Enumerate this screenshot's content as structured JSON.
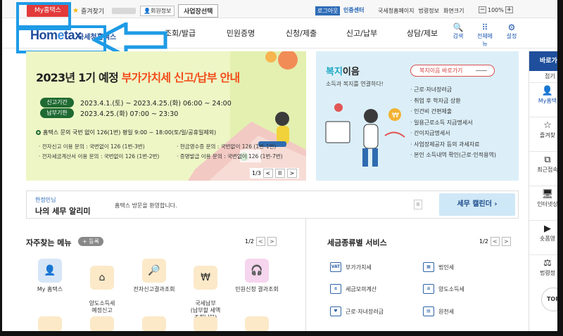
{
  "util": {
    "my_hometax": "My홈택스",
    "bookmark": "즐겨찾기",
    "member_info": "회원정보",
    "biz_select": "사업장선택",
    "logout": "로그아웃",
    "cert_center": "인증센터",
    "national_tax": "국세청홈페이지",
    "law_info": "법령정보",
    "screen_size": "화면크기",
    "zoom_minus": "−",
    "zoom": "100%",
    "zoom_plus": "+"
  },
  "header": {
    "logo_a": "Hom",
    "logo_b": "e",
    "logo_c": "tax",
    "logo_sub": "국세청홈택스",
    "nav": [
      "조회/발급",
      "민원증명",
      "신청/제출",
      "신고/납부",
      "상담/제보"
    ],
    "icons": [
      {
        "label": "검색",
        "icon": "search-icon",
        "glyph": "🔍"
      },
      {
        "label": "전체메뉴",
        "icon": "grid-icon",
        "glyph": "⠿"
      },
      {
        "label": "설정",
        "icon": "gear-icon",
        "glyph": "⚙"
      }
    ]
  },
  "banner": {
    "title_a": "2023년 1기 예정 ",
    "title_b": "부가가치세 신고/납부 안내",
    "period_label": "신고기간",
    "period_value": "2023.4.1.(토) ~ 2023.4.25.(화) 06:00 ~ 24:00",
    "due_label": "납부기한",
    "due_value": "2023.4.25.(화) 07:00 ~ 23:30",
    "inquiry": "홈택스 문의 국번 없이 126(1번) 평일 9:00 ~ 18:00(토/일/공휴일제외)",
    "inq1": "· 전자신고 이용 문의 : 국번없이 126 (1번-3번)",
    "inq2": "· 전자세금계산서 이용 문의 : 국번없이 126 (1번-2번)",
    "inq3": "· 현금영수증 문의 : 국번없이 126 (1번-1번)",
    "inq4": "· 증명발급 이용 문의 : 국번없이 126 (1번-7번)",
    "page": "1/3",
    "prev": "<",
    "pause": "II",
    "next": ">"
  },
  "welfare": {
    "title_a": "복지",
    "title_b": "이음",
    "subtitle": "소득과 복지를 연결하다!",
    "button": "복지이음 바로가기",
    "items": [
      "근로·자녀장려금",
      "취업 후 학자금 상환",
      "인건비 간편제출",
      "일용근로소득 지급명세서",
      "간이지급명세서",
      "사업장제공자 등의 과세자료",
      "본인 소득내역 확인(근로·인적용역)"
    ]
  },
  "notice": {
    "small": "한정민님",
    "big": "나의 세무 알리미",
    "welcome": "홈택스 방문을 환영합니다.",
    "pause": "II",
    "calendar": "세무 캘린더"
  },
  "fav": {
    "title": "자주찾는 메뉴",
    "register": "+ 등록",
    "page": "1/2",
    "prev": "<",
    "next": ">",
    "items": [
      {
        "label": "My 홈택스",
        "icon": "user-icon",
        "glyph": "👤",
        "bg": "#d6e6f7"
      },
      {
        "label": "양도소득세\n예정신고",
        "icon": "house-icon",
        "glyph": "⌂",
        "bg": "#fbe9c8"
      },
      {
        "label": "전자신고결과조회",
        "icon": "document-search-icon",
        "glyph": "🔎",
        "bg": "#fbe9c8"
      },
      {
        "label": "국세납부\n(납부할 세액\n조회납부)",
        "icon": "piggy-bank-icon",
        "glyph": "₩",
        "bg": "#fbe9c8"
      },
      {
        "label": "민원신청 결과조회",
        "icon": "headset-icon",
        "glyph": "🎧",
        "bg": "#f6d5ee"
      }
    ]
  },
  "services": {
    "title": "세금종류별 서비스",
    "page": "1/2",
    "prev": "<",
    "next": ">",
    "items": [
      {
        "label": "부가가치세",
        "icon": "vat-icon",
        "glyph": "VAT"
      },
      {
        "label": "법인세",
        "icon": "building-icon",
        "glyph": "▦"
      },
      {
        "label": "세금모의계산",
        "icon": "calculator-icon",
        "glyph": "±"
      },
      {
        "label": "양도소득세",
        "icon": "document-icon",
        "glyph": "≡"
      },
      {
        "label": "근로·자녀장려금",
        "icon": "heart-hand-icon",
        "glyph": "♥"
      },
      {
        "label": "원천세",
        "icon": "ledger-icon",
        "glyph": "▤"
      }
    ]
  },
  "quick": {
    "header": "바로가",
    "fold": "접기",
    "items": [
      {
        "label": "My홈택",
        "icon": "user-icon",
        "glyph": "👤"
      },
      {
        "label": "즐겨찾",
        "icon": "star-icon",
        "glyph": "☆"
      },
      {
        "label": "최근접속",
        "icon": "recent-icon",
        "glyph": "⧉"
      },
      {
        "label": "인터넷상",
        "icon": "monitor-icon",
        "glyph": "🖥"
      },
      {
        "label": "숏폼영",
        "icon": "video-icon",
        "glyph": "▶"
      },
      {
        "label": "법령정",
        "icon": "gavel-icon",
        "glyph": "⚖"
      }
    ],
    "top": "TOP"
  },
  "colors": {
    "highlight": "#1e9be6",
    "brand_blue": "#1f4b9a",
    "my_hometax": "#e23a3a",
    "banner_bg": "#eef6c6",
    "welfare_bg": "#dceff8"
  }
}
